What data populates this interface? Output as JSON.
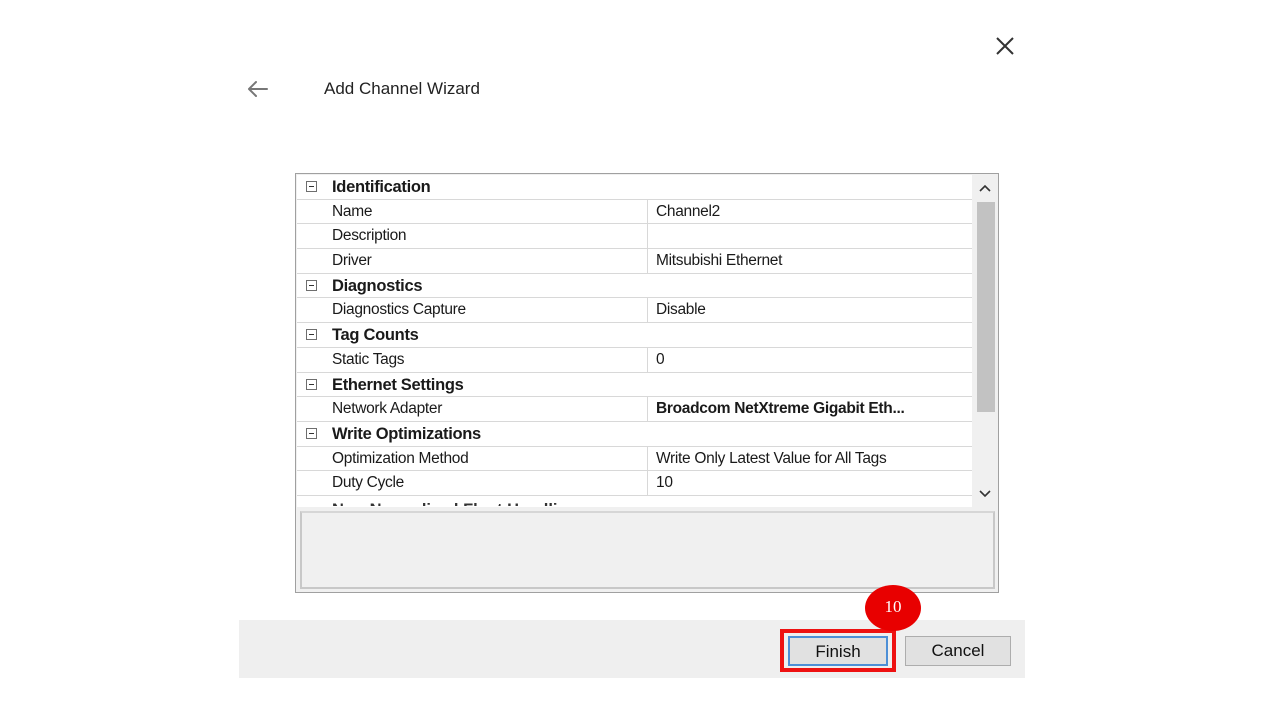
{
  "window": {
    "title": "Add Channel Wizard",
    "close_icon": "close-icon",
    "back_icon": "back-arrow-icon"
  },
  "property_grid": {
    "categories": [
      {
        "label": "Identification",
        "properties": [
          {
            "name": "Name",
            "value": "Channel2",
            "bold": false
          },
          {
            "name": "Description",
            "value": "",
            "bold": false
          },
          {
            "name": "Driver",
            "value": "Mitsubishi Ethernet",
            "bold": false
          }
        ]
      },
      {
        "label": "Diagnostics",
        "properties": [
          {
            "name": "Diagnostics Capture",
            "value": "Disable",
            "bold": false
          }
        ]
      },
      {
        "label": "Tag Counts",
        "properties": [
          {
            "name": "Static Tags",
            "value": "0",
            "bold": false
          }
        ]
      },
      {
        "label": "Ethernet Settings",
        "properties": [
          {
            "name": "Network Adapter",
            "value": "Broadcom NetXtreme Gigabit Eth...",
            "bold": true
          }
        ]
      },
      {
        "label": "Write Optimizations",
        "properties": [
          {
            "name": "Optimization Method",
            "value": "Write Only Latest Value for All Tags",
            "bold": false
          },
          {
            "name": "Duty Cycle",
            "value": "10",
            "bold": false
          }
        ]
      }
    ],
    "partial_next_category": "Non-Normalized Float Handling"
  },
  "buttons": {
    "finish": "Finish",
    "cancel": "Cancel"
  },
  "annotation": {
    "step_number": "10",
    "highlight_color": "#ee1111",
    "badge_color": "#e80000"
  },
  "colors": {
    "footer_bg": "#efefef",
    "finish_border": "#4d8fd6"
  }
}
